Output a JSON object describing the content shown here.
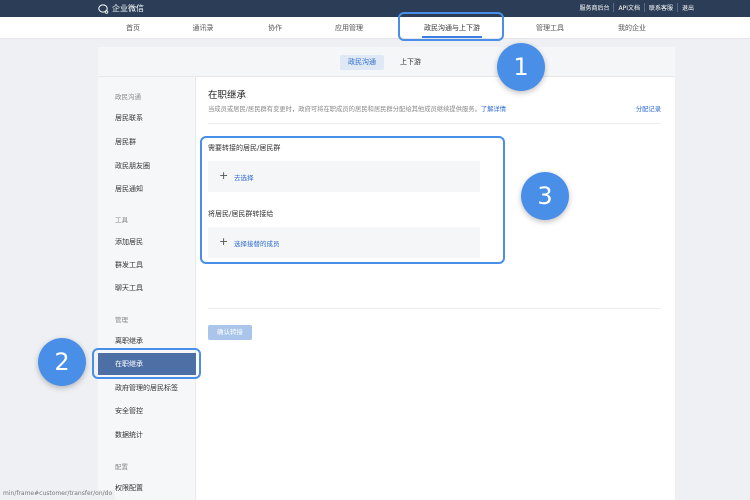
{
  "topbar": {
    "brand": "企业微信",
    "links": [
      "服务商后台",
      "API文档",
      "联系客服",
      "退出"
    ]
  },
  "mainnav": {
    "items": [
      "首页",
      "通讯录",
      "协作",
      "应用管理",
      "政民沟通与上下游",
      "管理工具",
      "我的企业"
    ],
    "active_index": 4
  },
  "subtabs": [
    "政民沟通",
    "上下游"
  ],
  "sidebar": {
    "groups": [
      {
        "label": "政民沟通",
        "items": [
          "居民联系",
          "居民群",
          "政民朋友圈",
          "居民通知"
        ]
      },
      {
        "label": "工具",
        "items": [
          "添加居民",
          "群发工具",
          "聊天工具"
        ]
      },
      {
        "label": "管理",
        "items": [
          "离职继承",
          "在职继承",
          "政府管理的居民标签",
          "安全管控",
          "数据统计"
        ]
      },
      {
        "label": "配置",
        "items": [
          "权限配置"
        ]
      }
    ],
    "active_item": "在职继承"
  },
  "content": {
    "title": "在职继承",
    "desc": "当成员或居民/居民群有变更时，政府可将在职成员的居民和居民群分配给其他成员继续提供服务。",
    "learn_more": "了解详情",
    "record_link": "分配记录",
    "section1_label": "需要转接的居民/居民群",
    "section1_action": "去选择",
    "section2_label": "将居民/居民群转接给",
    "section2_action": "选择接替的成员",
    "confirm_button": "确认转接"
  },
  "annotations": [
    "1",
    "2",
    "3"
  ],
  "status_url": "min/frame#customer/transfer/on/do",
  "colors": {
    "topbar": "#2c3e57",
    "accent": "#4a8fe7",
    "link": "#2d6bd0",
    "sidebar_active": "#4d6fa6"
  }
}
